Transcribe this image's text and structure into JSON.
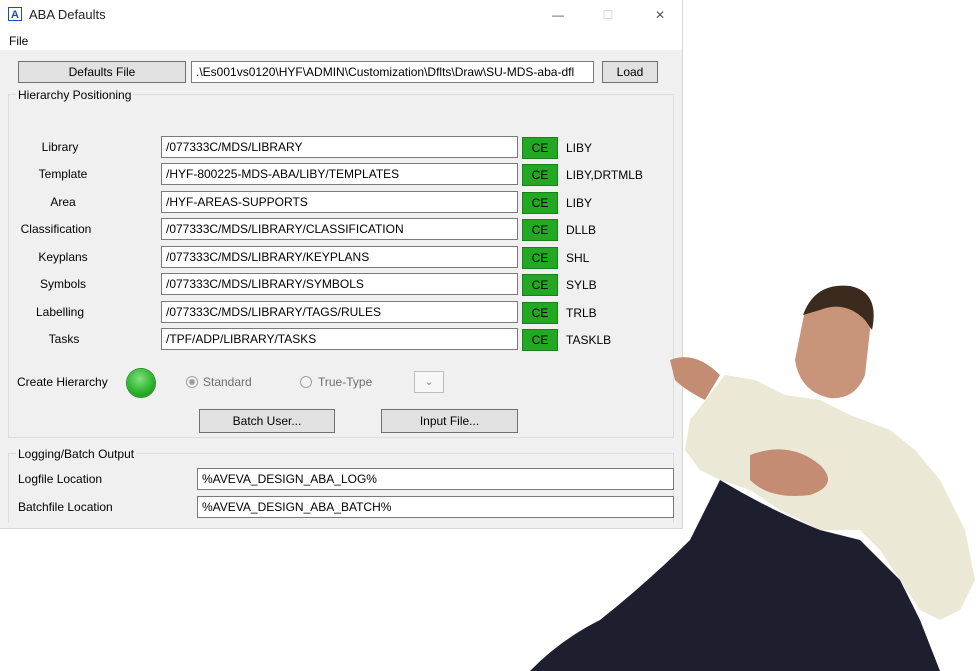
{
  "window": {
    "title": "ABA Defaults",
    "icon_letter": "A",
    "controls": {
      "minimize": "—",
      "maximize": "☐",
      "close": "✕"
    }
  },
  "menu": {
    "file": "File"
  },
  "top": {
    "defaults_file_button": "Defaults File",
    "defaults_file_path": ".\\Es001vs0120\\HYF\\ADMIN\\Customization\\Dflts\\Draw\\SU-MDS-aba-dfl",
    "load_button": "Load"
  },
  "hierarchy": {
    "group_title": "Hierarchy Positioning",
    "rows": [
      {
        "label": "Library",
        "path": "/077333C/MDS/LIBRARY",
        "ce": "CE",
        "code": "LIBY"
      },
      {
        "label": "Template",
        "path": "/HYF-800225-MDS-ABA/LIBY/TEMPLATES",
        "ce": "CE",
        "code": "LIBY,DRTMLB"
      },
      {
        "label": "Area",
        "path": "/HYF-AREAS-SUPPORTS",
        "ce": "CE",
        "code": "LIBY"
      },
      {
        "label": "Classification",
        "path": "/077333C/MDS/LIBRARY/CLASSIFICATION",
        "ce": "CE",
        "code": "DLLB"
      },
      {
        "label": "Keyplans",
        "path": "/077333C/MDS/LIBRARY/KEYPLANS",
        "ce": "CE",
        "code": "SHL"
      },
      {
        "label": "Symbols",
        "path": "/077333C/MDS/LIBRARY/SYMBOLS",
        "ce": "CE",
        "code": "SYLB"
      },
      {
        "label": "Labelling",
        "path": "/077333C/MDS/LIBRARY/TAGS/RULES",
        "ce": "CE",
        "code": "TRLB"
      },
      {
        "label": "Tasks",
        "path": "/TPF/ADP/LIBRARY/TASKS",
        "ce": "CE",
        "code": "TASKLB"
      }
    ],
    "create_hierarchy_label": "Create Hierarchy",
    "radio_standard": "Standard",
    "radio_true_type": "True-Type",
    "batch_user_button": "Batch User...",
    "input_file_button": "Input File...",
    "status_color": "#2fb52f",
    "ce_color": "#22a822"
  },
  "logging": {
    "group_title": "Logging/Batch Output",
    "logfile_label": "Logfile Location",
    "logfile_value": "%AVEVA_DESIGN_ABA_LOG%",
    "batchfile_label": "Batchfile Location",
    "batchfile_value": "%AVEVA_DESIGN_ABA_BATCH%"
  }
}
